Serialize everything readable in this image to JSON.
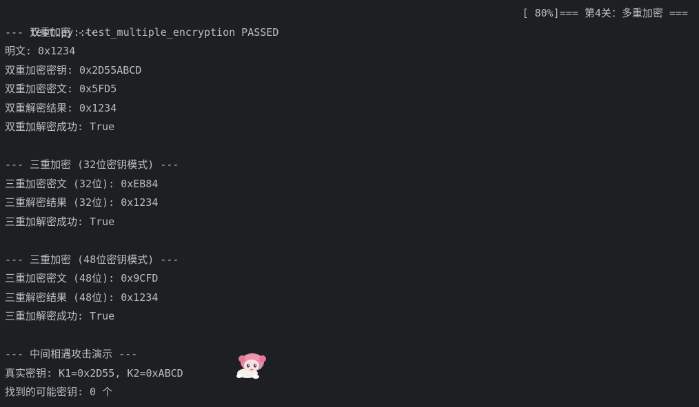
{
  "terminal": {
    "header": {
      "test_name": "test.py::test_multiple_encryption PASSED",
      "progress": "[ 80%]=== 第4关：多重加密 ==="
    },
    "lines": [
      "--- 双重加密 ---",
      "明文: 0x1234",
      "双重加密密钥: 0x2D55ABCD",
      "双重加密密文: 0x5FD5",
      "双重解密结果: 0x1234",
      "双重加解密成功: True",
      "",
      "--- 三重加密 (32位密钥模式) ---",
      "三重加密密文 (32位): 0xEB84",
      "三重解密结果 (32位): 0x1234",
      "三重加解密成功: True",
      "",
      "--- 三重加密 (48位密钥模式) ---",
      "三重加密密文 (48位): 0x9CFD",
      "三重解密结果 (48位): 0x1234",
      "三重加解密成功: True",
      "",
      "--- 中间相遇攻击演示 ---",
      "真实密钥: K1=0x2D55, K2=0xABCD",
      "找到的可能密钥: 0 个"
    ]
  },
  "colors": {
    "background": "#1e1f22",
    "text": "#bcbec4"
  },
  "sticker": {
    "icon": "anime-girl-sticker"
  }
}
